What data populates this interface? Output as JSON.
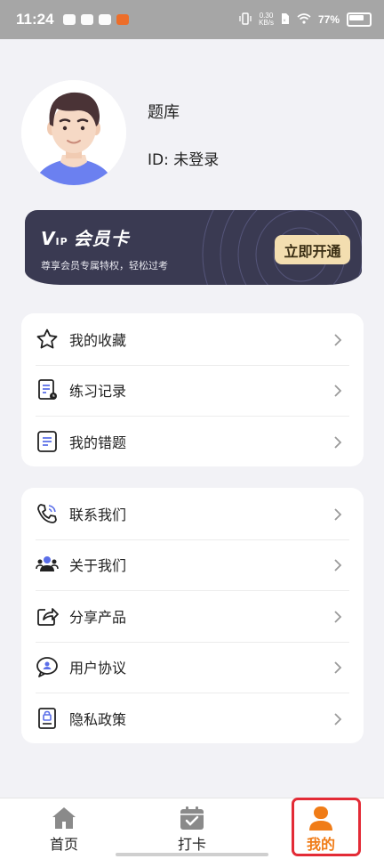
{
  "status_bar": {
    "time": "11:24",
    "net_speed_value": "0.30",
    "net_speed_unit": "KB/s",
    "battery": "77%"
  },
  "profile": {
    "name": "题库",
    "id_text": "ID: 未登录"
  },
  "vip": {
    "logo_v": "V",
    "logo_ip": "IP",
    "title": "会员卡",
    "subtitle": "尊享会员专属特权，轻松过考",
    "button": "立即开通"
  },
  "menu_group_1": [
    {
      "label": "我的收藏",
      "icon": "star-icon"
    },
    {
      "label": "练习记录",
      "icon": "record-icon"
    },
    {
      "label": "我的错题",
      "icon": "wrong-questions-icon"
    }
  ],
  "menu_group_2": [
    {
      "label": "联系我们",
      "icon": "phone-icon"
    },
    {
      "label": "关于我们",
      "icon": "people-icon"
    },
    {
      "label": "分享产品",
      "icon": "share-icon"
    },
    {
      "label": "用户协议",
      "icon": "agreement-icon"
    },
    {
      "label": "隐私政策",
      "icon": "privacy-icon"
    }
  ],
  "tabs": [
    {
      "label": "首页",
      "icon": "home-icon"
    },
    {
      "label": "打卡",
      "icon": "calendar-check-icon"
    },
    {
      "label": "我的",
      "icon": "person-icon",
      "active": true
    }
  ],
  "colors": {
    "accent": "#f07c17",
    "vip_bg": "#3a3a52",
    "vip_button": "#f3deb0",
    "highlight": "#e32b36"
  }
}
